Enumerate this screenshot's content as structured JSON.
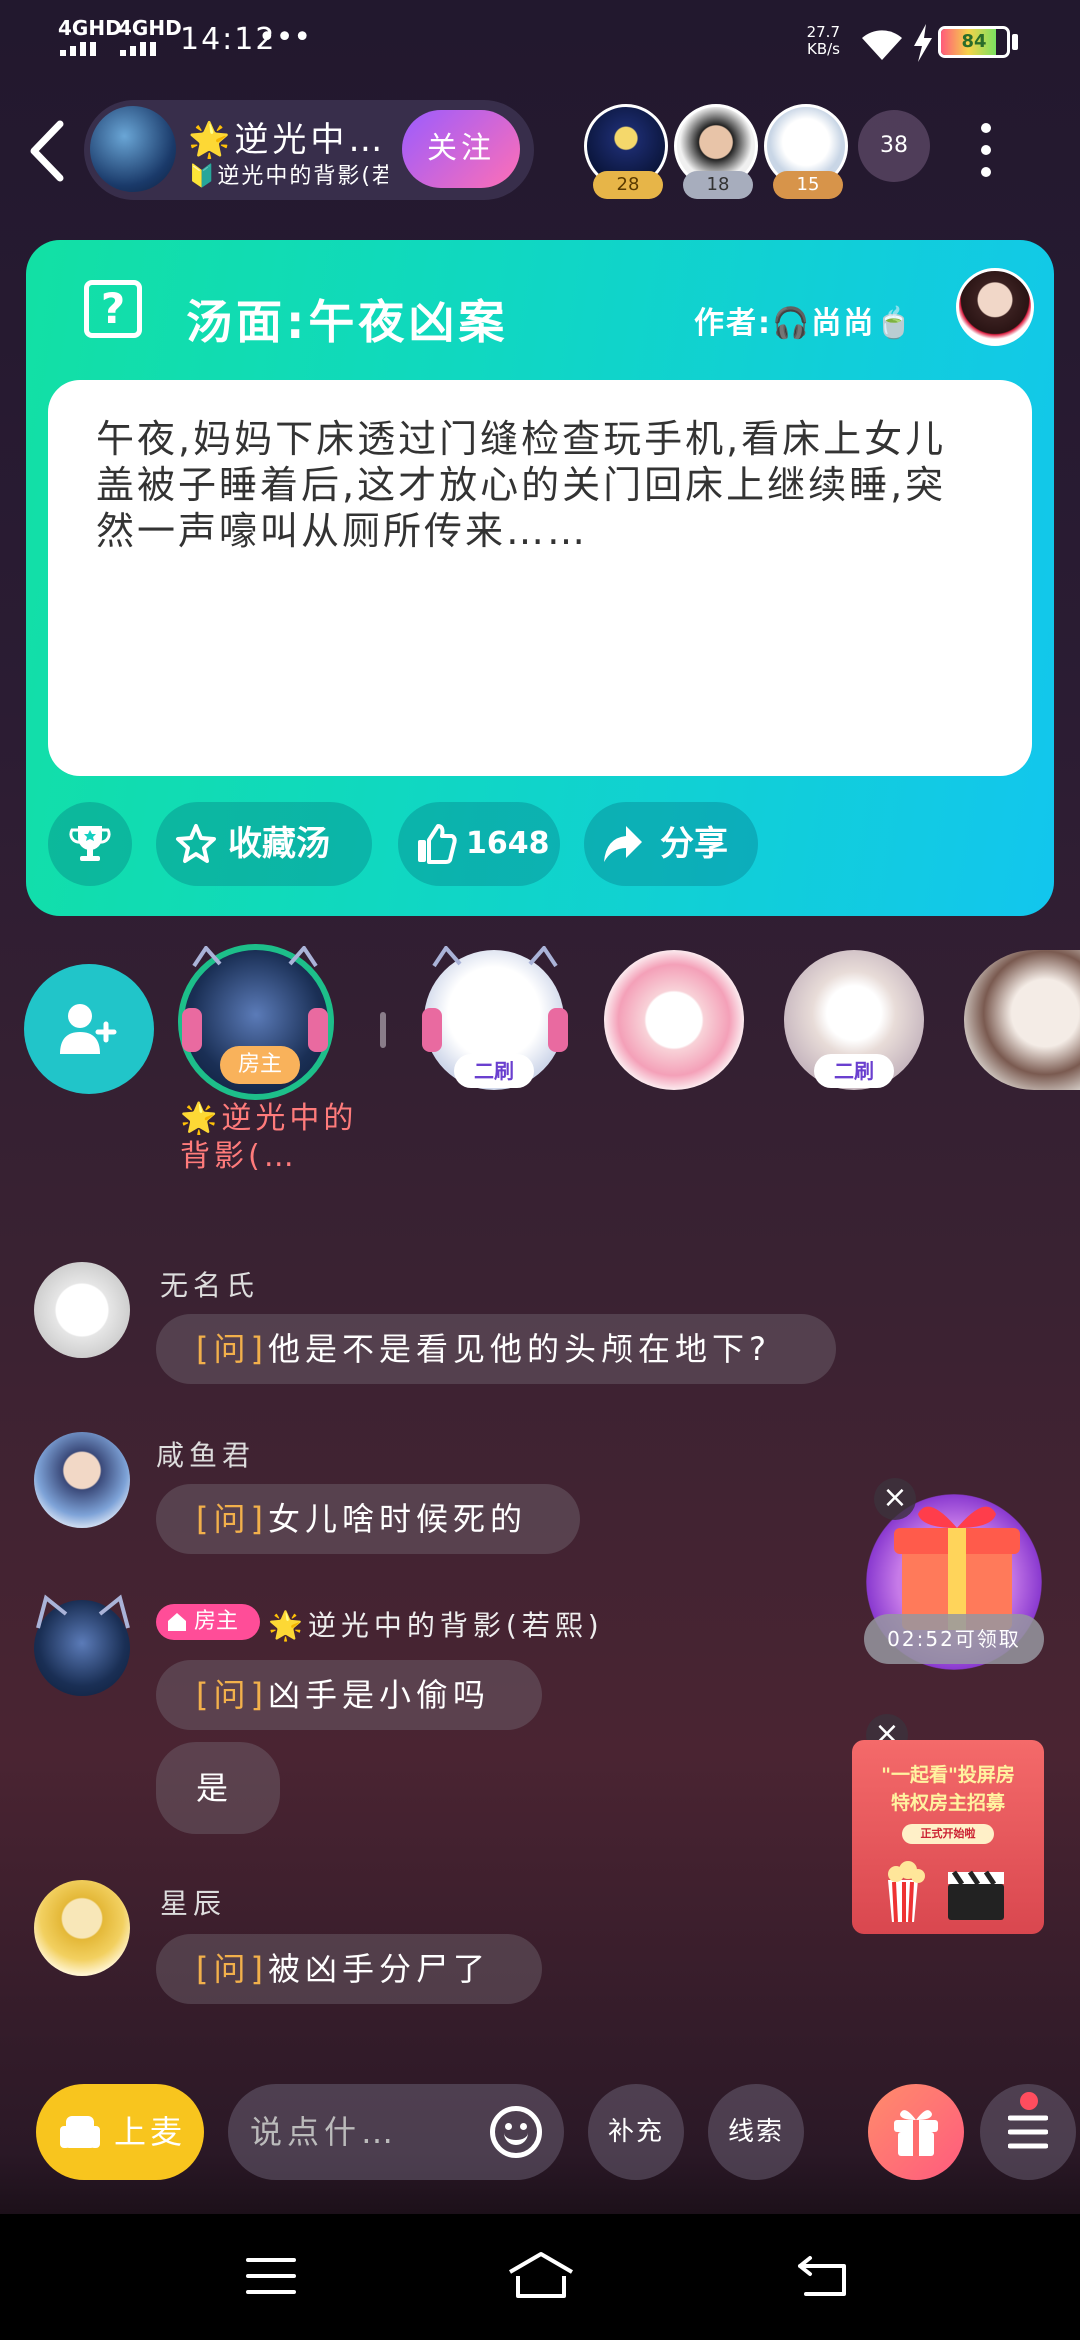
{
  "status_bar": {
    "network1": "4GHD",
    "network2": "4GHD",
    "time": "14:12",
    "dots": "•••",
    "speed_value": "27.7",
    "speed_unit": "KB/s",
    "battery": "84"
  },
  "header": {
    "host_name": "🌟逆光中…",
    "host_sub": "🔰逆光中的背影(若熙",
    "follow_label": "关注",
    "ranks": [
      "28",
      "18",
      "15"
    ],
    "viewer_count": "38"
  },
  "riddle": {
    "title": "汤面:午夜凶案",
    "author": "作者:🎧尚尚🍵",
    "body": "午夜,妈妈下床透过门缝检查玩手机,看床上女儿盖被子睡着后,这才放心的关门回床上继续睡,突然一声嚎叫从厕所传来……",
    "favorite_label": "收藏汤",
    "like_count": "1648",
    "share_label": "分享"
  },
  "seats": {
    "host_tag": "房主",
    "host_name": "🌟逆光中的背影(…",
    "tag_second": "二刷",
    "tag_fourth": "二刷"
  },
  "chat": [
    {
      "name": "无名氏",
      "prefix": "[问]",
      "text": "他是不是看见他的头颅在地下?"
    },
    {
      "name": "咸鱼君",
      "prefix": "[问]",
      "text": "女儿啥时候死的"
    },
    {
      "name": "🌟逆光中的背影(若熙)",
      "badge": "房主",
      "prefix": "[问]",
      "text": "凶手是小偷吗",
      "reply": "是"
    },
    {
      "name": "星辰",
      "prefix": "[问]",
      "text": "被凶手分尸了"
    }
  ],
  "widgets": {
    "gift_timer": "02:52可领取",
    "promo_line1": "\"一起看\"投屏房",
    "promo_line2": "特权房主招募",
    "promo_line3": "正式开始啦"
  },
  "bottom_bar": {
    "mic_label": "上麦",
    "input_placeholder": "说点什…",
    "supplement_label": "补充",
    "clue_label": "线索"
  },
  "colors": {
    "card_gradient_start": "#12e0a4",
    "card_gradient_end": "#12c6ee",
    "follow_start": "#9a5cff",
    "follow_end": "#ff6fb5",
    "mic_button": "#f8c51e",
    "question_prefix": "#f2b04b",
    "host_name": "#ff7b7b"
  },
  "icons": {
    "back": "chevron-left-icon",
    "more": "more-vertical-icon",
    "question": "question-box-icon",
    "trophy": "trophy-icon",
    "star": "star-icon",
    "like": "thumbs-up-icon",
    "share": "share-arrow-icon",
    "add_seat": "add-user-icon",
    "emoji": "emoji-icon",
    "gift": "gift-icon",
    "menu": "menu-icon"
  }
}
